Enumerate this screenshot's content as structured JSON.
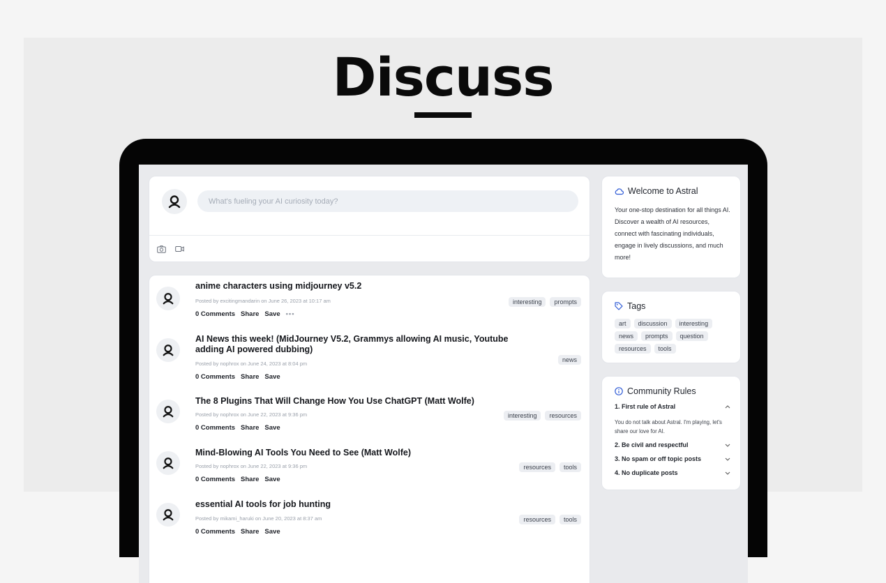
{
  "hero": {
    "title": "Discuss"
  },
  "composer": {
    "placeholder": "What's fueling your AI curiosity today?",
    "tools": [
      "camera-icon",
      "video-icon"
    ]
  },
  "posts": [
    {
      "title": "anime characters using midjourney v5.2",
      "meta": "Posted by excitingmandarin on June 26, 2023 at 10:17 am",
      "comments": "0 Comments",
      "share": "Share",
      "save": "Save",
      "more": "•••",
      "tags": [
        "interesting",
        "prompts"
      ]
    },
    {
      "title": "AI News this week! (MidJourney V5.2, Grammys allowing AI music, Youtube adding AI powered dubbing)",
      "meta": "Posted by nophrox on June 24, 2023 at 8:04 pm",
      "comments": "0 Comments",
      "share": "Share",
      "save": "Save",
      "tags": [
        "news"
      ]
    },
    {
      "title": "The 8 Plugins That Will Change How You Use ChatGPT (Matt Wolfe)",
      "meta": "Posted by nophrox on June 22, 2023 at 9:36 pm",
      "comments": "0 Comments",
      "share": "Share",
      "save": "Save",
      "tags": [
        "interesting",
        "resources"
      ]
    },
    {
      "title": "Mind-Blowing AI Tools You Need to See (Matt Wolfe)",
      "meta": "Posted by nophrox on June 22, 2023 at 9:36 pm",
      "comments": "0 Comments",
      "share": "Share",
      "save": "Save",
      "tags": [
        "resources",
        "tools"
      ]
    },
    {
      "title": "essential AI tools for job hunting",
      "meta": "Posted by mikami_haruki on June 20, 2023 at 8:37 am",
      "comments": "0 Comments",
      "share": "Share",
      "save": "Save",
      "tags": [
        "resources",
        "tools"
      ]
    }
  ],
  "welcome": {
    "title": "Welcome to Astral",
    "body": "Your one-stop destination for all things AI. Discover a wealth of AI resources, connect with fascinating individuals, engage in lively discussions, and much more!"
  },
  "tags": {
    "title": "Tags",
    "items": [
      "art",
      "discussion",
      "interesting",
      "news",
      "prompts",
      "question",
      "resources",
      "tools"
    ]
  },
  "rules": {
    "title": "Community Rules",
    "items": [
      {
        "label": "1. First rule of Astral",
        "expanded": true,
        "body": "You do not talk about Astral. I'm playing, let's share our love for AI."
      },
      {
        "label": "2. Be civil and respectful",
        "expanded": false
      },
      {
        "label": "3. No spam or off topic posts",
        "expanded": false
      },
      {
        "label": "4. No duplicate posts",
        "expanded": false
      }
    ]
  }
}
